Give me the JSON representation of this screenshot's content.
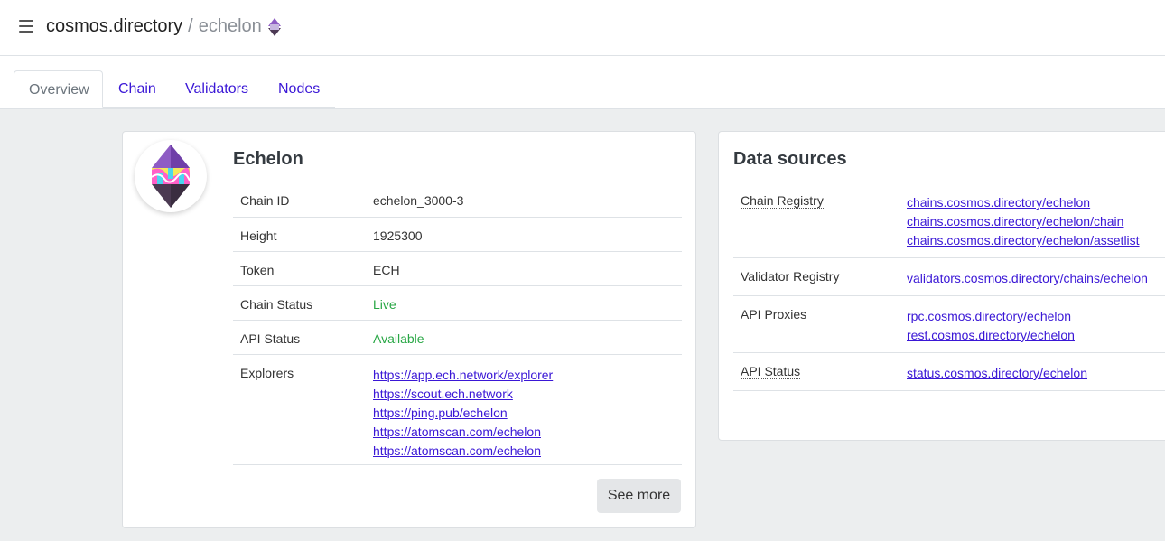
{
  "header": {
    "site_name": "cosmos.directory",
    "separator": "/",
    "chain_slug": "echelon",
    "menu_icon": "hamburger-icon",
    "chain_logo_icon": "echelon-logo-icon"
  },
  "tabs": [
    {
      "label": "Overview",
      "active": true
    },
    {
      "label": "Chain",
      "active": false
    },
    {
      "label": "Validators",
      "active": false
    },
    {
      "label": "Nodes",
      "active": false
    }
  ],
  "overview": {
    "title": "Echelon",
    "rows": [
      {
        "key": "Chain ID",
        "value": "echelon_3000-3"
      },
      {
        "key": "Height",
        "value": "1925300"
      },
      {
        "key": "Token",
        "value": "ECH"
      },
      {
        "key": "Chain Status",
        "value": "Live"
      },
      {
        "key": "API Status",
        "value": "Available"
      }
    ],
    "explorers_label": "Explorers",
    "explorers": [
      "https://app.ech.network/explorer",
      "https://scout.ech.network",
      "https://ping.pub/echelon",
      "https://atomscan.com/echelon",
      "https://atomscan.com/echelon"
    ],
    "see_more_label": "See more"
  },
  "data_sources": {
    "title": "Data sources",
    "rows": [
      {
        "key": "Chain Registry",
        "links": [
          "chains.cosmos.directory/echelon",
          "chains.cosmos.directory/echelon/chain",
          "chains.cosmos.directory/echelon/assetlist"
        ]
      },
      {
        "key": "Validator Registry",
        "links": [
          "validators.cosmos.directory/chains/echelon"
        ]
      },
      {
        "key": "API Proxies",
        "links": [
          "rpc.cosmos.directory/echelon",
          "rest.cosmos.directory/echelon"
        ]
      },
      {
        "key": "API Status",
        "links": [
          "status.cosmos.directory/echelon"
        ]
      }
    ]
  },
  "colors": {
    "link": "#3a17d6",
    "status_green": "#28a745",
    "logo_purple": "#7b4bb0"
  }
}
